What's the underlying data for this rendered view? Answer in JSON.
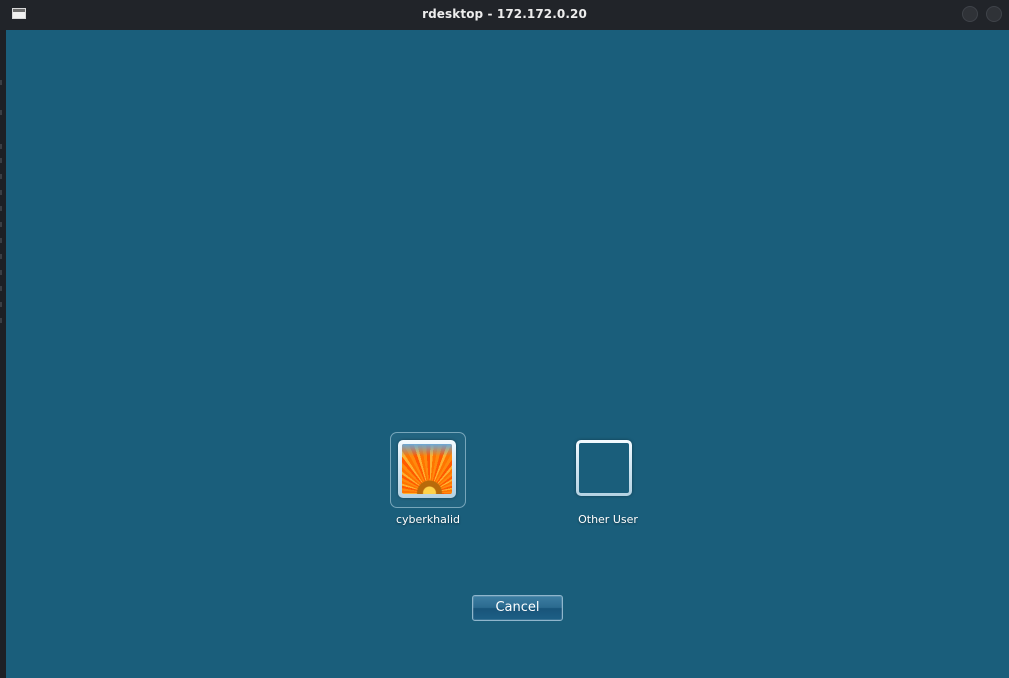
{
  "window": {
    "title": "rdesktop - 172.172.0.20",
    "icon": "window-icon"
  },
  "login": {
    "users": [
      {
        "name": "cyberkhalid",
        "avatar": "orange-flower-icon"
      },
      {
        "name": "Other User",
        "avatar": "blank-user-icon"
      }
    ],
    "cancel_label": "Cancel"
  },
  "colors": {
    "background": "#1a5e7b",
    "titlebar": "#212429"
  }
}
